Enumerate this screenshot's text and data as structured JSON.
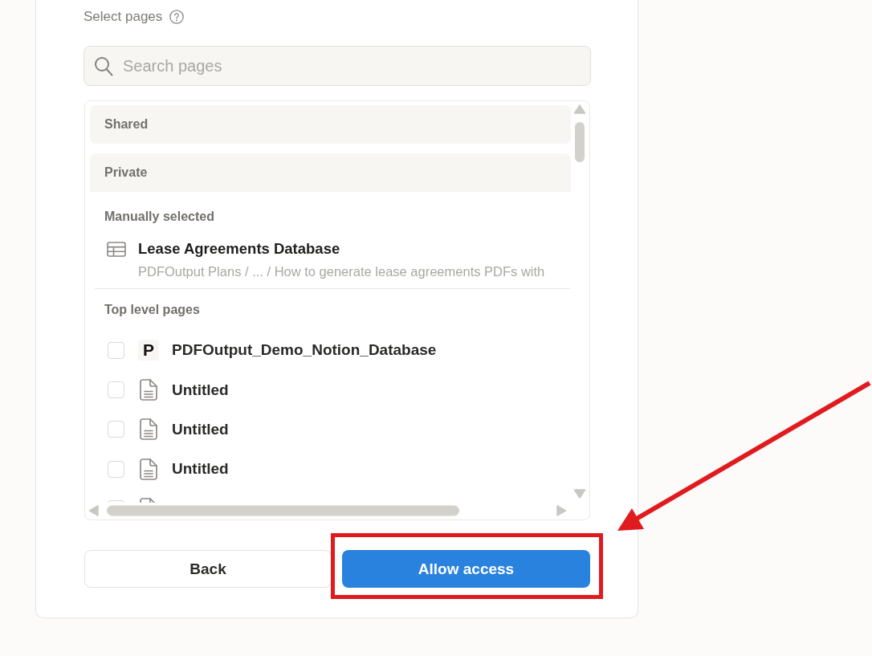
{
  "header": {
    "label": "Select pages",
    "help": true
  },
  "search": {
    "placeholder": "Search pages"
  },
  "page_list": {
    "groups": [
      {
        "label": "Shared",
        "expanded": false
      },
      {
        "label": "Private",
        "expanded": true,
        "sections": [
          {
            "kind": "manual",
            "heading": "Manually selected",
            "items": [
              {
                "kind": "database",
                "title": "Lease Agreements Database",
                "path": "PDFOutput Plans / ... / How to generate lease agreements PDFs with"
              }
            ]
          },
          {
            "kind": "checklist",
            "heading": "Top level pages",
            "items": [
              {
                "kind": "logo",
                "logo_text": "P",
                "title": "PDFOutput_Demo_Notion_Database",
                "checked": false
              },
              {
                "kind": "page",
                "title": "Untitled",
                "checked": false
              },
              {
                "kind": "page",
                "title": "Untitled",
                "checked": false
              },
              {
                "kind": "page",
                "title": "Untitled",
                "checked": false
              },
              {
                "kind": "page",
                "checked": false
              }
            ]
          }
        ]
      }
    ]
  },
  "buttons": [
    {
      "label": "Back",
      "kind": "secondary"
    },
    {
      "label": "Allow access",
      "kind": "primary"
    }
  ],
  "overlay": {
    "highlight_frame": true,
    "pointer_arrow": true
  }
}
